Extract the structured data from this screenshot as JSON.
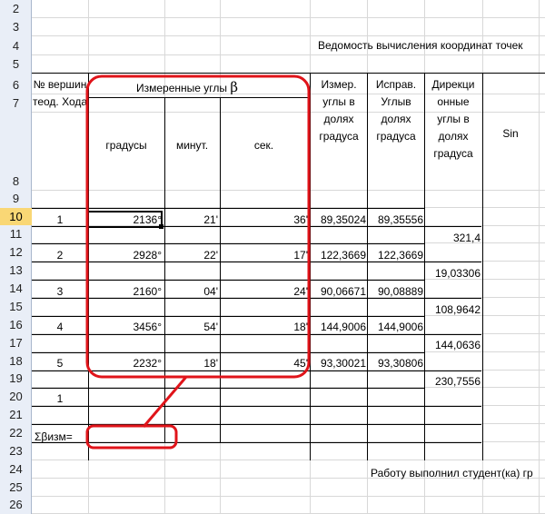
{
  "row_numbers": [
    "2",
    "3",
    "4",
    "5",
    "6",
    "7",
    "8",
    "9",
    "10",
    "11",
    "12",
    "13",
    "14",
    "15",
    "16",
    "17",
    "18",
    "19",
    "20",
    "21",
    "22",
    "23",
    "24",
    "25",
    "26"
  ],
  "active_row": "10",
  "title": "Ведомость вычисления координат точек",
  "headers": {
    "vertex": "№ вершин теод. Хода",
    "measured_angles": "Измеренные углы",
    "beta_symbol": "β",
    "degrees": "градусы",
    "minutes": "минут.",
    "seconds": "сек.",
    "measured_fraction": "Измер. углы в долях градуса",
    "corrected_fraction": "Исправ. Углыв долях градуса",
    "directional": "Дирекци онные углы в долях градуса",
    "sin": "Sin"
  },
  "rows": [
    {
      "vertex": "1",
      "deg": "2136°",
      "min": "21'",
      "sec": "36'",
      "meas": "89,35024",
      "corr": "89,35556"
    },
    {
      "vertex": "2",
      "deg": "2928°",
      "min": "22'",
      "sec": "17'",
      "meas": "122,3669",
      "corr": "122,3669"
    },
    {
      "vertex": "3",
      "deg": "2160°",
      "min": "04'",
      "sec": "24'",
      "meas": "90,06671",
      "corr": "90,08889"
    },
    {
      "vertex": "4",
      "deg": "3456°",
      "min": "54'",
      "sec": "18'",
      "meas": "144,9006",
      "corr": "144,9006"
    },
    {
      "vertex": "5",
      "deg": "2232°",
      "min": "18'",
      "sec": "45'",
      "meas": "93,30021",
      "corr": "93,30806"
    }
  ],
  "directional_values": [
    "321,4",
    "19,03306",
    "108,9642",
    "144,0636",
    "230,7556"
  ],
  "row20_vertex": "1",
  "sum_label": "Σβизм=",
  "footer_text": "Работу выполнил студент(ка) гр",
  "annotation_color": "#e0141a"
}
